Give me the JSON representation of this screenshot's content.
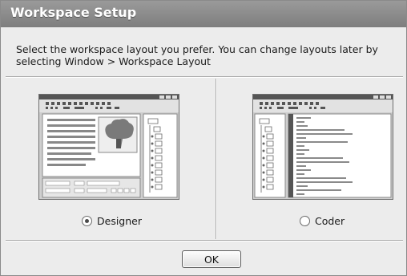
{
  "window": {
    "title": "Workspace Setup"
  },
  "instructions": "Select the workspace layout you prefer. You can change layouts later by selecting Window > Workspace Layout",
  "options": [
    {
      "label": "Designer",
      "selected": true,
      "preview_icon": "designer-layout-preview"
    },
    {
      "label": "Coder",
      "selected": false,
      "preview_icon": "coder-layout-preview"
    }
  ],
  "buttons": {
    "ok_label": "OK"
  }
}
